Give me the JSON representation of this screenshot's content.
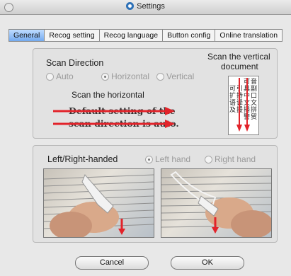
{
  "window": {
    "title": "Settings"
  },
  "tabs": [
    {
      "label": "General",
      "active": true
    },
    {
      "label": "Recog setting",
      "active": false
    },
    {
      "label": "Recog language",
      "active": false
    },
    {
      "label": "Button config",
      "active": false
    },
    {
      "label": "Online translation",
      "active": false
    }
  ],
  "scan": {
    "title": "Scan Direction",
    "options": [
      {
        "label": "Auto",
        "selected": false
      },
      {
        "label": "Horizontal",
        "selected": true
      },
      {
        "label": "Vertical",
        "selected": false
      }
    ],
    "horizontal_caption": "Scan the horizontal",
    "horizontal_sample_line1": "Default setting of  the",
    "horizontal_sample_line2": "scan direction is auto.",
    "vertical_caption_line1": "Scan the vertical",
    "vertical_caption_line2": "document",
    "vertical_sample_columns": [
      "音副口文拼贸",
      "可具中文播警",
      "引持译援",
      "可扩语及"
    ]
  },
  "hand": {
    "title": "Left/Right-handed",
    "options": [
      {
        "label": "Left hand",
        "selected": true
      },
      {
        "label": "Right hand",
        "selected": false
      }
    ]
  },
  "buttons": {
    "cancel": "Cancel",
    "ok": "OK"
  },
  "colors": {
    "arrow": "#e2232a",
    "tab_active": "#8fbcf4",
    "scan_text": "#333333"
  }
}
